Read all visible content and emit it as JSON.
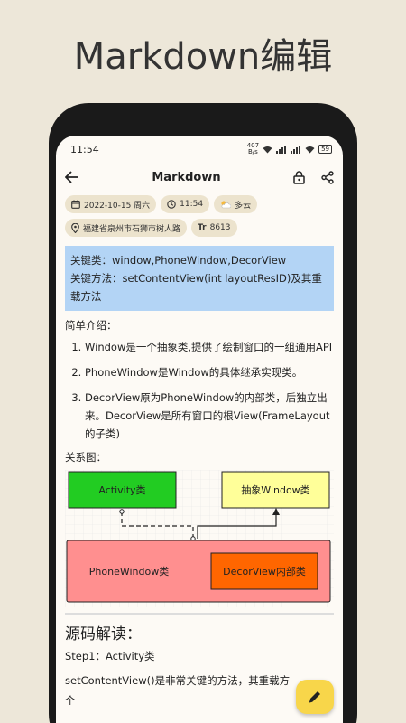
{
  "promo_title": "Markdown编辑",
  "status": {
    "time": "11:54",
    "speed_top": "407",
    "speed_bottom": "B/s",
    "battery": "59"
  },
  "appbar": {
    "title": "Markdown"
  },
  "chips": {
    "date": "2022-10-15 周六",
    "time": "11:54",
    "weather": "多云",
    "location": "福建省泉州市石狮市树人路",
    "word_count_icon": "Tr",
    "word_count": "8613"
  },
  "doc": {
    "blue_line1": "关键类：window,PhoneWindow,DecorView",
    "blue_line2": "关键方法：setContentView(int layoutResID)及其重载方法",
    "intro": "简单介绍：",
    "list": [
      "Window是一个抽象类,提供了绘制窗口的一组通用API",
      "PhoneWindow是Window的具体继承实现类。",
      "DecorView原为PhoneWindow的内部类，后独立出来。DecorView是所有窗口的根View(FrameLayout的子类)"
    ],
    "relation": "关系图：",
    "diagram": {
      "activity": "Activity类",
      "window": "抽象Window类",
      "phonewindow": "PhoneWindow类",
      "decorview": "DecorView内部类"
    },
    "heading": "源码解读：",
    "step1": "Step1：Activity类",
    "last_line1": "setContentView()是非常关键的方法，其重载方",
    "last_line2": "个"
  },
  "colors": {
    "background": "#ede7d9",
    "chip": "#ece3cd",
    "blue_box": "#b3d4f5",
    "activity_box": "#22cc22",
    "window_box": "#ffff99",
    "phonewindow_box": "#ff8f8f",
    "decorview_box": "#ff6600",
    "fab": "#f8d64a"
  }
}
